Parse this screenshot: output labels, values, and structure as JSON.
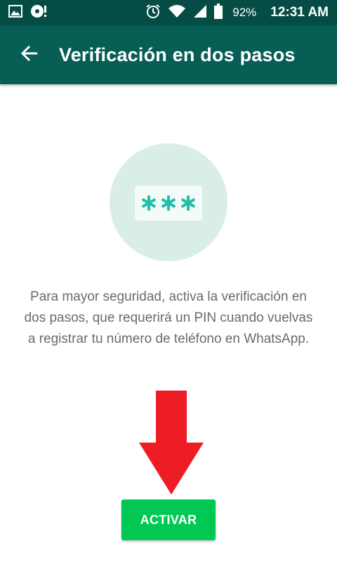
{
  "status_bar": {
    "battery": "92%",
    "time": "12:31 AM",
    "icons_left": [
      "image-icon",
      "media-icon"
    ],
    "icons_right": [
      "alarm-icon",
      "wifi-icon",
      "signal-icon",
      "battery-icon"
    ]
  },
  "app_bar": {
    "title": "Verificación en dos pasos",
    "back_icon": "arrow-back-icon"
  },
  "illustration": {
    "pin_icon": "pin-asterisks-icon"
  },
  "main": {
    "description": "Para mayor seguridad, activa la verificación en dos pasos, que requerirá un PIN cuando vuelvas a registrar tu número de teléfono en WhatsApp.",
    "activate_label": "ACTIVAR"
  },
  "colors": {
    "status_bar": "#054d44",
    "app_bar": "#075e54",
    "accent_green": "#00c853",
    "illustration_bg": "#d9eee7",
    "pin_teal": "#1fbfa9",
    "arrow_red": "#ee1c25"
  }
}
